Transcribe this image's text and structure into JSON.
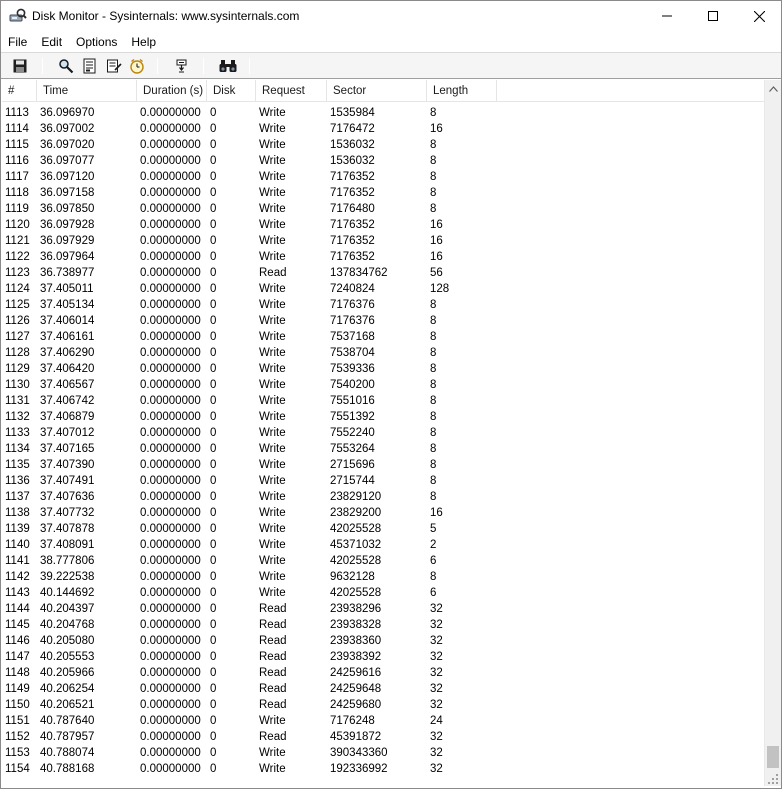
{
  "window": {
    "title": "Disk Monitor - Sysinternals: www.sysinternals.com"
  },
  "icons": {
    "app": "disk-monitor-icon",
    "minimize": "minimize-icon",
    "maximize": "maximize-icon",
    "close": "close-icon",
    "save": "save-icon",
    "find": "magnifier-icon",
    "capture": "capture-icon",
    "autoscroll": "autoscroll-icon",
    "clock": "clock-icon",
    "filter": "filter-icon",
    "binoculars": "binoculars-icon"
  },
  "menu": [
    "File",
    "Edit",
    "Options",
    "Help"
  ],
  "columns": [
    "#",
    "Time",
    "Duration (s)",
    "Disk",
    "Request",
    "Sector",
    "Length"
  ],
  "rows": [
    [
      "1113",
      "36.096970",
      "0.00000000",
      "0",
      "Write",
      "1535984",
      "8"
    ],
    [
      "1114",
      "36.097002",
      "0.00000000",
      "0",
      "Write",
      "7176472",
      "16"
    ],
    [
      "1115",
      "36.097020",
      "0.00000000",
      "0",
      "Write",
      "1536032",
      "8"
    ],
    [
      "1116",
      "36.097077",
      "0.00000000",
      "0",
      "Write",
      "1536032",
      "8"
    ],
    [
      "1117",
      "36.097120",
      "0.00000000",
      "0",
      "Write",
      "7176352",
      "8"
    ],
    [
      "1118",
      "36.097158",
      "0.00000000",
      "0",
      "Write",
      "7176352",
      "8"
    ],
    [
      "1119",
      "36.097850",
      "0.00000000",
      "0",
      "Write",
      "7176480",
      "8"
    ],
    [
      "1120",
      "36.097928",
      "0.00000000",
      "0",
      "Write",
      "7176352",
      "16"
    ],
    [
      "1121",
      "36.097929",
      "0.00000000",
      "0",
      "Write",
      "7176352",
      "16"
    ],
    [
      "1122",
      "36.097964",
      "0.00000000",
      "0",
      "Write",
      "7176352",
      "16"
    ],
    [
      "1123",
      "36.738977",
      "0.00000000",
      "0",
      "Read",
      "137834762",
      "56"
    ],
    [
      "1124",
      "37.405011",
      "0.00000000",
      "0",
      "Write",
      "7240824",
      "128"
    ],
    [
      "1125",
      "37.405134",
      "0.00000000",
      "0",
      "Write",
      "7176376",
      "8"
    ],
    [
      "1126",
      "37.406014",
      "0.00000000",
      "0",
      "Write",
      "7176376",
      "8"
    ],
    [
      "1127",
      "37.406161",
      "0.00000000",
      "0",
      "Write",
      "7537168",
      "8"
    ],
    [
      "1128",
      "37.406290",
      "0.00000000",
      "0",
      "Write",
      "7538704",
      "8"
    ],
    [
      "1129",
      "37.406420",
      "0.00000000",
      "0",
      "Write",
      "7539336",
      "8"
    ],
    [
      "1130",
      "37.406567",
      "0.00000000",
      "0",
      "Write",
      "7540200",
      "8"
    ],
    [
      "1131",
      "37.406742",
      "0.00000000",
      "0",
      "Write",
      "7551016",
      "8"
    ],
    [
      "1132",
      "37.406879",
      "0.00000000",
      "0",
      "Write",
      "7551392",
      "8"
    ],
    [
      "1133",
      "37.407012",
      "0.00000000",
      "0",
      "Write",
      "7552240",
      "8"
    ],
    [
      "1134",
      "37.407165",
      "0.00000000",
      "0",
      "Write",
      "7553264",
      "8"
    ],
    [
      "1135",
      "37.407390",
      "0.00000000",
      "0",
      "Write",
      "2715696",
      "8"
    ],
    [
      "1136",
      "37.407491",
      "0.00000000",
      "0",
      "Write",
      "2715744",
      "8"
    ],
    [
      "1137",
      "37.407636",
      "0.00000000",
      "0",
      "Write",
      "23829120",
      "8"
    ],
    [
      "1138",
      "37.407732",
      "0.00000000",
      "0",
      "Write",
      "23829200",
      "16"
    ],
    [
      "1139",
      "37.407878",
      "0.00000000",
      "0",
      "Write",
      "42025528",
      "5"
    ],
    [
      "1140",
      "37.408091",
      "0.00000000",
      "0",
      "Write",
      "45371032",
      "2"
    ],
    [
      "1141",
      "38.777806",
      "0.00000000",
      "0",
      "Write",
      "42025528",
      "6"
    ],
    [
      "1142",
      "39.222538",
      "0.00000000",
      "0",
      "Write",
      "9632128",
      "8"
    ],
    [
      "1143",
      "40.144692",
      "0.00000000",
      "0",
      "Write",
      "42025528",
      "6"
    ],
    [
      "1144",
      "40.204397",
      "0.00000000",
      "0",
      "Read",
      "23938296",
      "32"
    ],
    [
      "1145",
      "40.204768",
      "0.00000000",
      "0",
      "Read",
      "23938328",
      "32"
    ],
    [
      "1146",
      "40.205080",
      "0.00000000",
      "0",
      "Read",
      "23938360",
      "32"
    ],
    [
      "1147",
      "40.205553",
      "0.00000000",
      "0",
      "Read",
      "23938392",
      "32"
    ],
    [
      "1148",
      "40.205966",
      "0.00000000",
      "0",
      "Read",
      "24259616",
      "32"
    ],
    [
      "1149",
      "40.206254",
      "0.00000000",
      "0",
      "Read",
      "24259648",
      "32"
    ],
    [
      "1150",
      "40.206521",
      "0.00000000",
      "0",
      "Read",
      "24259680",
      "32"
    ],
    [
      "1151",
      "40.787640",
      "0.00000000",
      "0",
      "Write",
      "7176248",
      "24"
    ],
    [
      "1152",
      "40.787957",
      "0.00000000",
      "0",
      "Read",
      "45391872",
      "32"
    ],
    [
      "1153",
      "40.788074",
      "0.00000000",
      "0",
      "Write",
      "390343360",
      "32"
    ],
    [
      "1154",
      "40.788168",
      "0.00000000",
      "0",
      "Write",
      "192336992",
      "32"
    ]
  ]
}
